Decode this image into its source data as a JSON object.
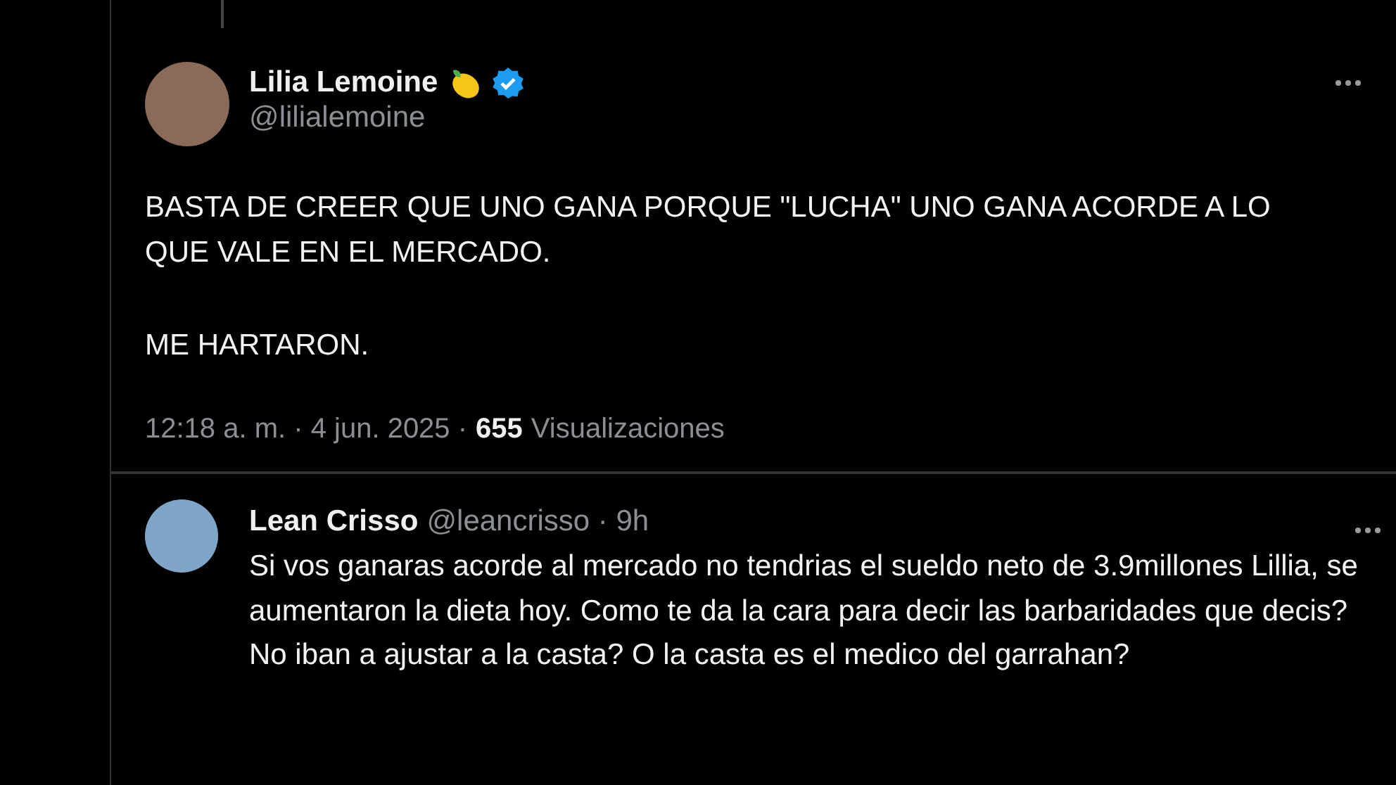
{
  "main_tweet": {
    "name": "Lilia Lemoine",
    "handle": "@lilialemoine",
    "paragraphs": [
      "BASTA DE CREER QUE UNO GANA PORQUE \"LUCHA\" UNO GANA ACORDE A LO QUE VALE EN EL MERCADO.",
      "ME HARTARON."
    ],
    "time": "12:18 a. m. · 4 jun. 2025 ·",
    "views": "655",
    "views_label": "Visualizaciones",
    "verified": true
  },
  "reply": {
    "name": "Lean Crisso",
    "handle": "@leancrisso · 9h",
    "text": "Si vos ganaras acorde al mercado no tendrias el sueldo neto de 3.9millones Lillia, se aumentaron la dieta hoy. Como te da la cara para decir las barbaridades que decis? No iban a ajustar a la casta? O la casta es el medico del garrahan?"
  }
}
